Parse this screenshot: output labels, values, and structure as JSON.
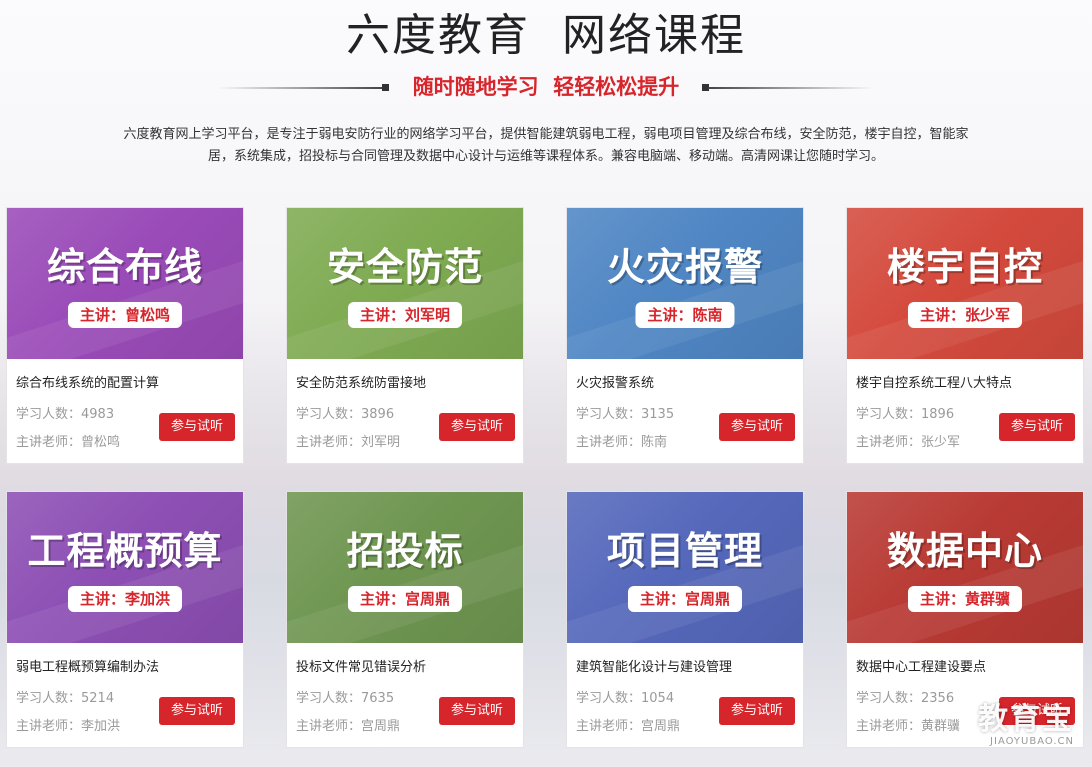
{
  "header": {
    "title": "六度教育  网络课程",
    "subtitle": "随时随地学习  轻轻松松提升",
    "description": "六度教育网上学习平台，是专注于弱电安防行业的网络学习平台，提供智能建筑弱电工程，弱电项目管理及综合布线，安全防范，楼宇自控，智能家居，系统集成，招投标与合同管理及数据中心设计与运维等课程体系。兼容电脑端、移动端。高清网课让您随时学习。"
  },
  "labels": {
    "learners_prefix": "学习人数：",
    "teacher_prefix": "主讲老师：",
    "tag_prefix": "主讲：",
    "try_button": "参与试听"
  },
  "colors": {
    "accent": "#d6252b"
  },
  "courses": [
    {
      "title": "综合布线",
      "teacher": "曾松鸣",
      "lesson": "综合布线系统的配置计算",
      "learners": "4983",
      "color": "#9a4bb8"
    },
    {
      "title": "安全防范",
      "teacher": "刘军明",
      "lesson": "安全防范系统防雷接地",
      "learners": "3896",
      "color": "#7fab52"
    },
    {
      "title": "火灾报警",
      "teacher": "陈南",
      "lesson": "火灾报警系统",
      "learners": "3135",
      "color": "#4f86c4"
    },
    {
      "title": "楼宇自控",
      "teacher": "张少军",
      "lesson": "楼宇自控系统工程八大特点",
      "learners": "1896",
      "color": "#d44a3d"
    },
    {
      "title": "工程概预算",
      "teacher": "李加洪",
      "lesson": "弱电工程概预算编制办法",
      "learners": "5214",
      "color": "#8d4fb4"
    },
    {
      "title": "招投标",
      "teacher": "宫周鼎",
      "lesson": "投标文件常见错误分析",
      "learners": "7635",
      "color": "#6f9651"
    },
    {
      "title": "项目管理",
      "teacher": "宫周鼎",
      "lesson": "建筑智能化设计与建设管理",
      "learners": "1054",
      "color": "#5568bb"
    },
    {
      "title": "数据中心",
      "teacher": "黄群骥",
      "lesson": "数据中心工程建设要点",
      "learners": "2356",
      "color": "#b93a34"
    }
  ],
  "watermark": {
    "main": "教育宝",
    "sub": "JIAOYUBAO.CN"
  }
}
